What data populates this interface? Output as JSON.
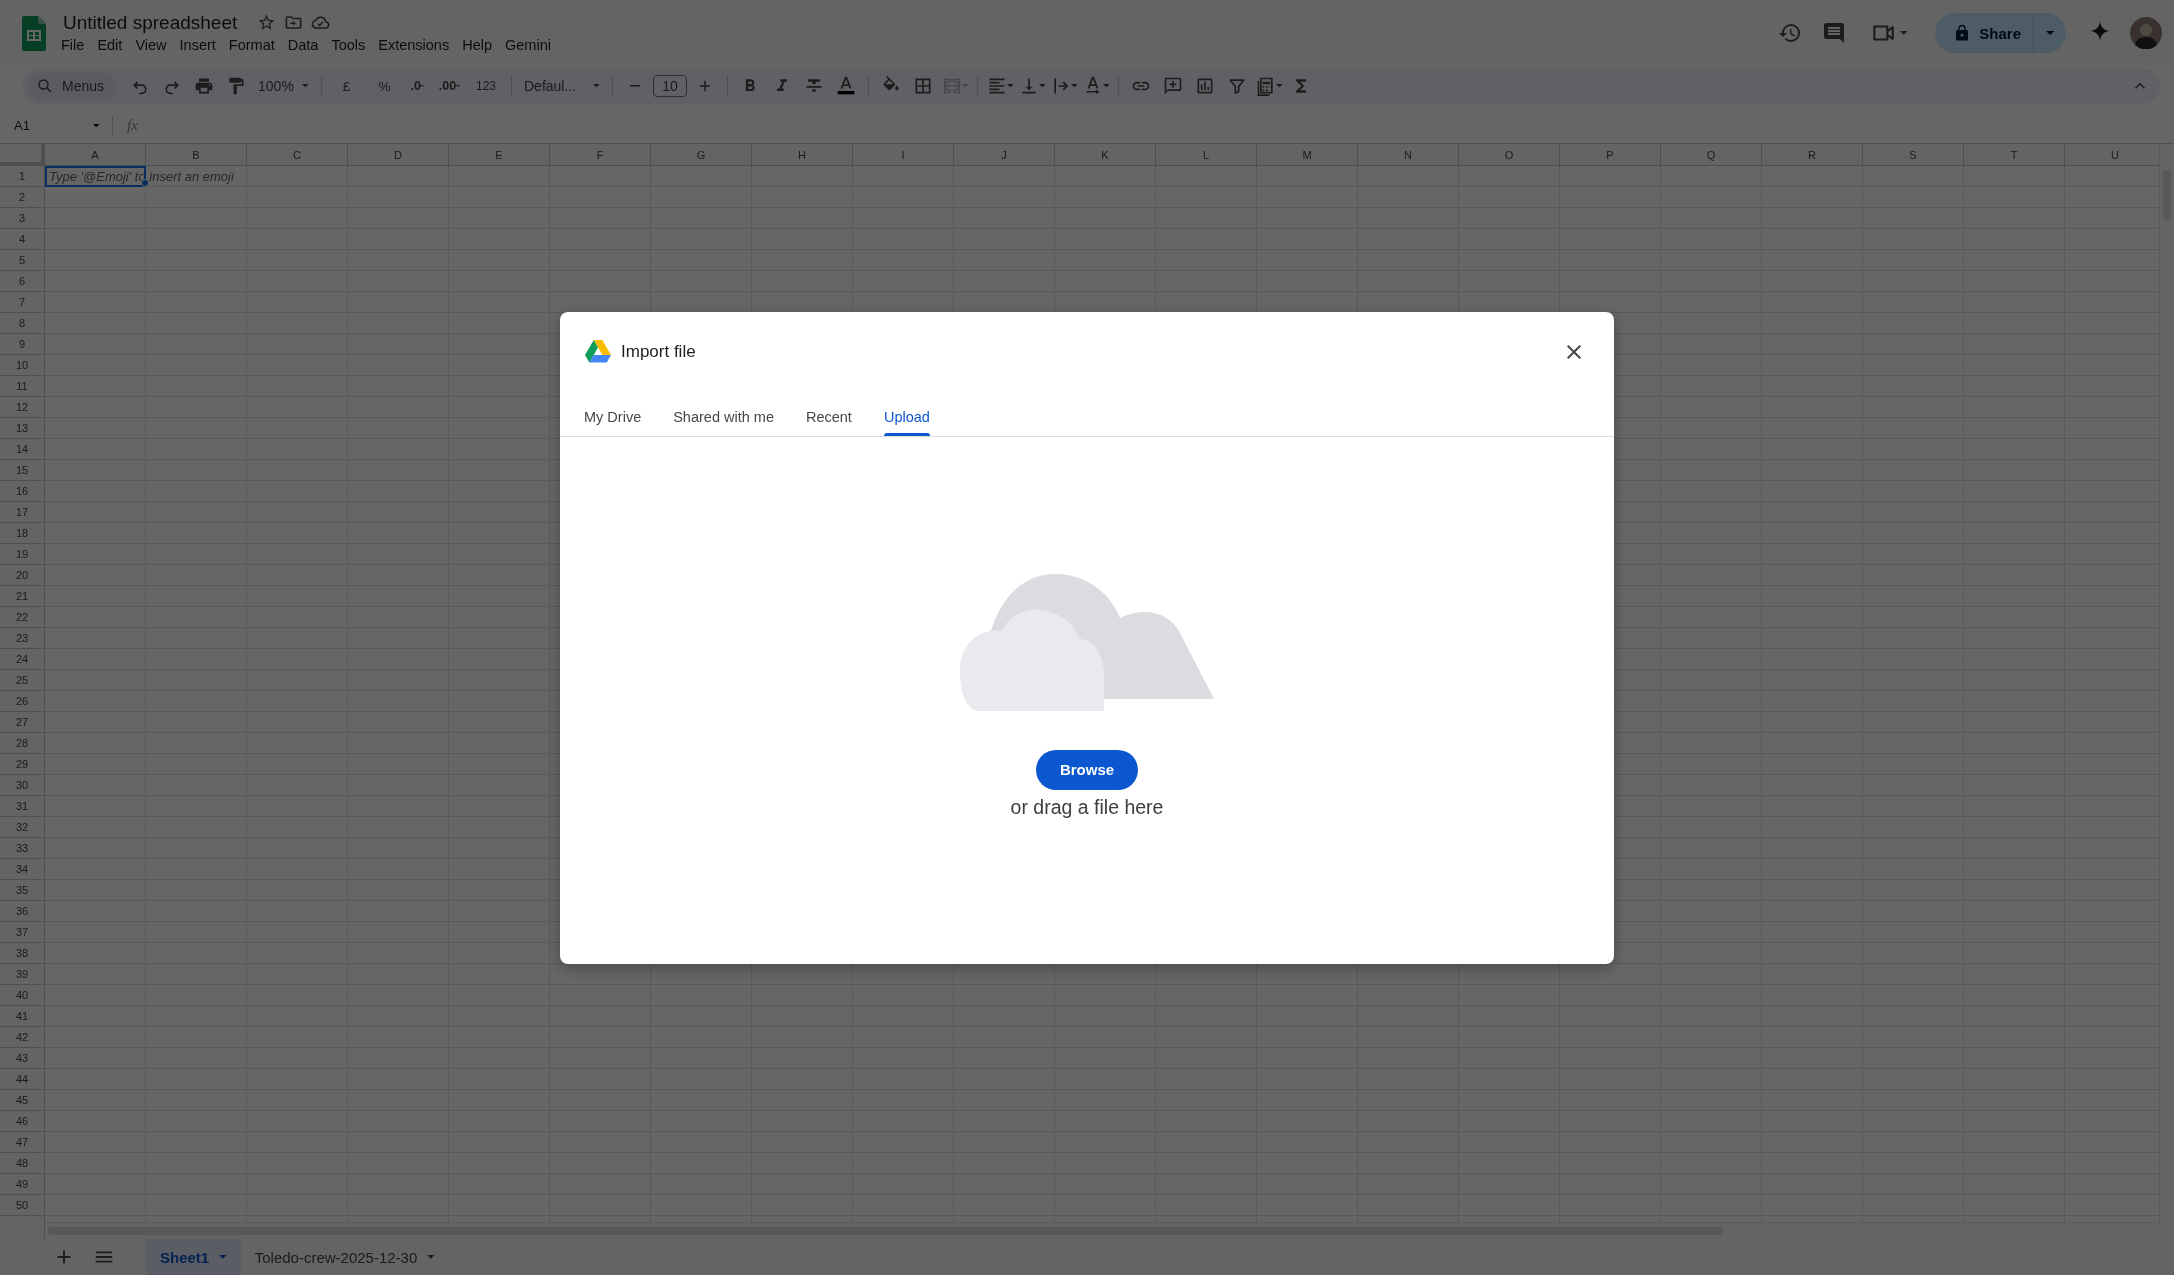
{
  "app": {
    "title": "Untitled spreadsheet",
    "menus": [
      "File",
      "Edit",
      "View",
      "Insert",
      "Format",
      "Data",
      "Tools",
      "Extensions",
      "Help",
      "Gemini"
    ],
    "share": "Share"
  },
  "toolbar": {
    "search": "Menus",
    "zoom": "100%",
    "currency": "£",
    "percent": "%",
    "decimal_decrease": ".0",
    "decimal_increase": ".00",
    "number_format": "123",
    "font": "Defaul...",
    "font_size": "10",
    "merge_disabled": true
  },
  "formula_bar": {
    "cell_ref": "A1",
    "function_symbol": "fx"
  },
  "sheet": {
    "columns": [
      "A",
      "B",
      "C",
      "D",
      "E",
      "F",
      "G",
      "H",
      "I",
      "J",
      "K",
      "L",
      "M",
      "N",
      "O",
      "P",
      "Q",
      "R",
      "S",
      "T",
      "U"
    ],
    "rows": [
      "1",
      "2",
      "3",
      "4",
      "5",
      "6",
      "7",
      "8",
      "9",
      "10",
      "11",
      "12",
      "13",
      "14",
      "15",
      "16",
      "17",
      "18",
      "19",
      "20",
      "21",
      "22",
      "23",
      "24",
      "25",
      "26",
      "27",
      "28",
      "29",
      "30",
      "31",
      "32",
      "33",
      "34",
      "35",
      "36",
      "37",
      "38",
      "39",
      "40",
      "41",
      "42",
      "43",
      "44",
      "45",
      "46",
      "47",
      "48",
      "49",
      "50"
    ],
    "active_cell": {
      "placeholder": "Type '@Emoji' to insert an emoji"
    }
  },
  "sheet_tabs": [
    {
      "label": "Sheet1",
      "selected": true
    },
    {
      "label": "Toledo-crew-2025-12-30",
      "selected": false
    }
  ],
  "dialog": {
    "title": "Import file",
    "tabs": [
      {
        "label": "My Drive",
        "selected": false
      },
      {
        "label": "Shared with me",
        "selected": false
      },
      {
        "label": "Recent",
        "selected": false
      },
      {
        "label": "Upload",
        "selected": true
      }
    ],
    "browse": "Browse",
    "hint": "or drag a file here"
  }
}
